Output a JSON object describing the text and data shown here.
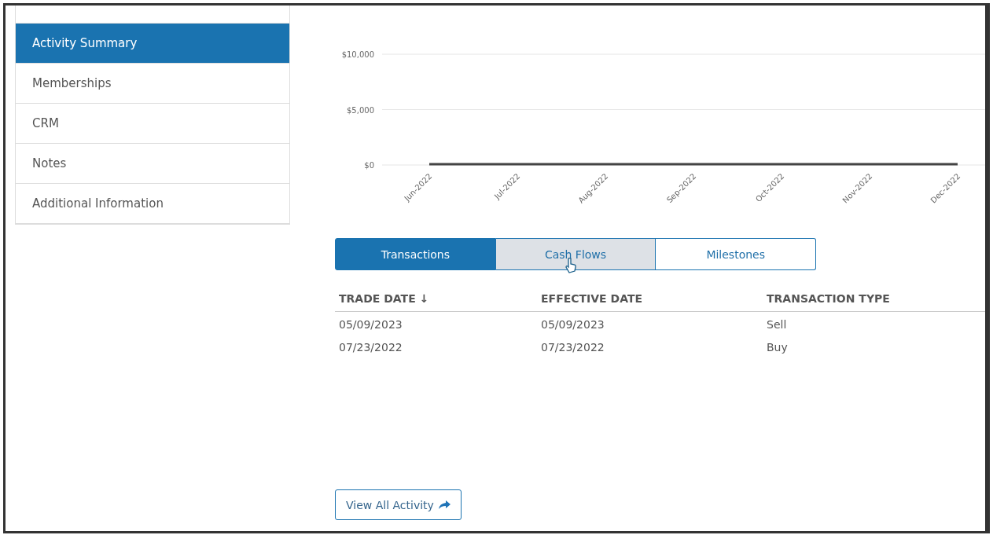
{
  "sidebar": {
    "items": [
      {
        "kind": "stub",
        "selected": false
      },
      {
        "kind": "link",
        "label": "Activity Summary",
        "selected": true
      },
      {
        "kind": "link",
        "label": "Memberships",
        "selected": false
      },
      {
        "kind": "link",
        "label": "CRM",
        "selected": false
      },
      {
        "kind": "link",
        "label": "Notes",
        "selected": false
      },
      {
        "kind": "link",
        "label": "Additional Information",
        "selected": false
      }
    ]
  },
  "chart": {
    "chart_data": {
      "type": "line",
      "categories": [
        "Jun-2022",
        "Jul-2022",
        "Aug-2022",
        "Sep-2022",
        "Oct-2022",
        "Nov-2022",
        "Dec-2022"
      ],
      "series": [
        {
          "color": "#444444",
          "values": [
            0,
            0,
            0,
            0,
            0,
            0,
            0
          ]
        }
      ],
      "ylim": [
        0,
        10000
      ],
      "yticks": [
        {
          "value": 0,
          "label": "$0"
        },
        {
          "value": 5000,
          "label": "$5,000"
        },
        {
          "value": 10000,
          "label": "$10,000"
        }
      ]
    }
  },
  "tabs": [
    {
      "label": "Transactions",
      "selected": true,
      "hovered": false
    },
    {
      "label": "Cash Flows",
      "selected": false,
      "hovered": true
    },
    {
      "label": "Milestones",
      "selected": false,
      "hovered": false
    }
  ],
  "table": {
    "columns": [
      "TRADE DATE ↓",
      "EFFECTIVE DATE",
      "TRANSACTION TYPE"
    ],
    "rows": [
      [
        "05/09/2023",
        "05/09/2023",
        "Sell"
      ],
      [
        "07/23/2022",
        "07/23/2022",
        "Buy"
      ]
    ]
  },
  "view_all_button": {
    "label": "View All Activity"
  }
}
